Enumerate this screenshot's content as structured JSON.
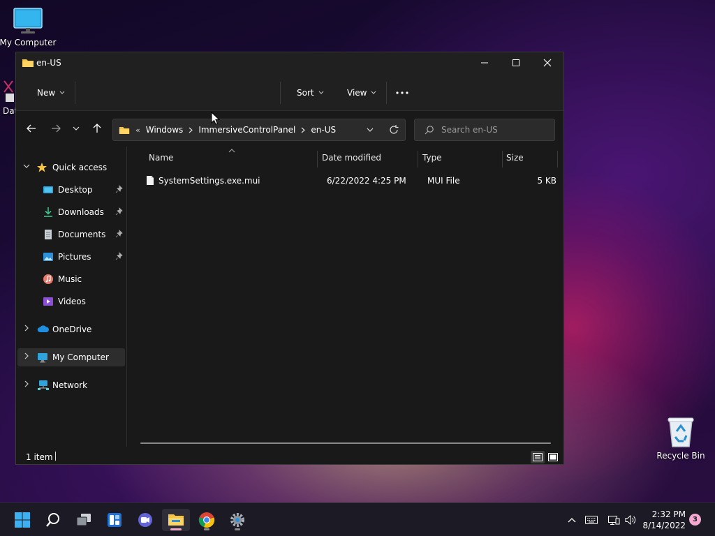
{
  "desktop": {
    "my_computer_label": "My Computer",
    "recycle_bin_label": "Recycle Bin",
    "partial_icon_label": "Data"
  },
  "window": {
    "title": "en-US",
    "commands": {
      "new_label": "New",
      "sort_label": "Sort",
      "view_label": "View"
    },
    "address": {
      "overflow": "«",
      "crumbs": [
        "Windows",
        "ImmersiveControlPanel",
        "en-US"
      ]
    },
    "search": {
      "placeholder": "Search en-US"
    },
    "nav": {
      "quick_access": "Quick access",
      "desktop": "Desktop",
      "downloads": "Downloads",
      "documents": "Documents",
      "pictures": "Pictures",
      "music": "Music",
      "videos": "Videos",
      "onedrive": "OneDrive",
      "my_computer": "My Computer",
      "network": "Network"
    },
    "columns": [
      "Name",
      "Date modified",
      "Type",
      "Size"
    ],
    "files": [
      {
        "name": "SystemSettings.exe.mui",
        "date": "6/22/2022 4:25 PM",
        "type": "MUI File",
        "size": "5 KB"
      }
    ],
    "status": "1 item"
  },
  "taskbar": {
    "time": "2:32 PM",
    "date": "8/14/2022",
    "notifications": "3"
  },
  "colors": {
    "accent": "#f0a5c5",
    "folder": "#f6c444",
    "window_bg": "#191919"
  }
}
